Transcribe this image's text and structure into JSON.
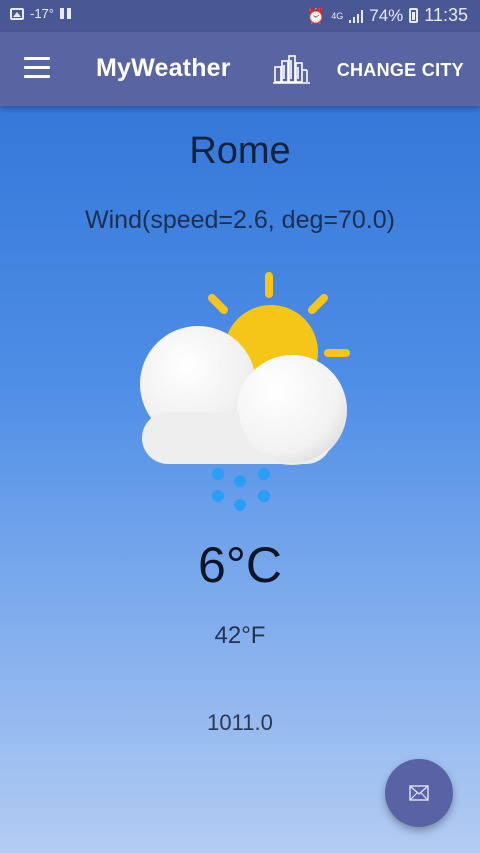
{
  "status_bar": {
    "temperature": "-17°",
    "network": "4G",
    "battery_percent": "74%",
    "time": "11:35",
    "icons": [
      "image-icon",
      "pause-icon",
      "alarm-icon",
      "signal-icon",
      "battery-icon"
    ]
  },
  "app_bar": {
    "title": "MyWeather",
    "change_city_label": "CHANGE CITY",
    "icons": [
      "menu-icon",
      "city-chart-icon"
    ]
  },
  "weather": {
    "city": "Rome",
    "wind": "Wind(speed=2.6, deg=70.0)",
    "icon": "partly-cloudy-snow-icon",
    "temp_c": "6°C",
    "temp_f": "42°F",
    "pressure": "1011.0"
  },
  "fab": {
    "icon": "mail-icon"
  },
  "colors": {
    "app_bar": "#5964a3",
    "status_bar": "#4a5795",
    "background_top": "#2a6fd3",
    "background_bottom": "#b3ccf2",
    "sun": "#f5c518",
    "snow": "#2a9df4",
    "fab": "#5a62a6"
  }
}
